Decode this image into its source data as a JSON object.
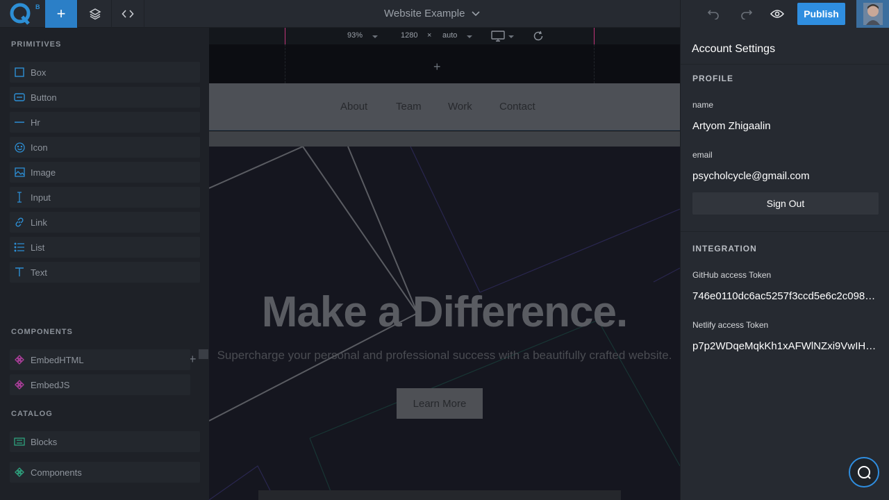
{
  "app": {
    "logo_sup": "B"
  },
  "topbar": {
    "site_title": "Website Example"
  },
  "toolbar": {
    "zoom": "93%",
    "width": "1280",
    "times": "×",
    "height": "auto"
  },
  "left": {
    "primitives_title": "PRIMITIVES",
    "primitives": [
      {
        "label": "Box",
        "icon": "box-icon"
      },
      {
        "label": "Button",
        "icon": "button-icon"
      },
      {
        "label": "Hr",
        "icon": "hr-icon"
      },
      {
        "label": "Icon",
        "icon": "smiley-icon"
      },
      {
        "label": "Image",
        "icon": "image-icon"
      },
      {
        "label": "Input",
        "icon": "text-cursor-icon"
      },
      {
        "label": "Link",
        "icon": "link-icon"
      },
      {
        "label": "List",
        "icon": "list-icon"
      },
      {
        "label": "Text",
        "icon": "text-icon"
      }
    ],
    "components_title": "COMPONENTS",
    "components": [
      {
        "label": "EmbedHTML"
      },
      {
        "label": "EmbedJS"
      }
    ],
    "catalog_title": "CATALOG",
    "catalog": [
      {
        "label": "Blocks"
      },
      {
        "label": "Components"
      }
    ]
  },
  "canvas": {
    "nav": [
      "About",
      "Team",
      "Work",
      "Contact"
    ],
    "headline": "Make a Difference.",
    "subheadline": "Supercharge your personal and professional success with a beautifully crafted website.",
    "cta": "Learn More"
  },
  "panel": {
    "publish": "Publish",
    "title": "Account Settings",
    "profile_title": "PROFILE",
    "name_label": "name",
    "name_value": "Artyom Zhigaalin",
    "email_label": "email",
    "email_value": "psycholcycle@gmail.com",
    "signout": "Sign Out",
    "integration_title": "INTEGRATION",
    "github_label": "GitHub access Token",
    "github_value": "746e0110dc6ac5257f3ccd5e6c2c098b…",
    "netlify_label": "Netlify access Token",
    "netlify_value": "p7p2WDqeMqkKh1xAFWlNZxi9VwIHZ…"
  },
  "colors": {
    "accent": "#2f8ee0",
    "panel_bg": "#262a31",
    "canvas_bg": "#0c0d12"
  }
}
